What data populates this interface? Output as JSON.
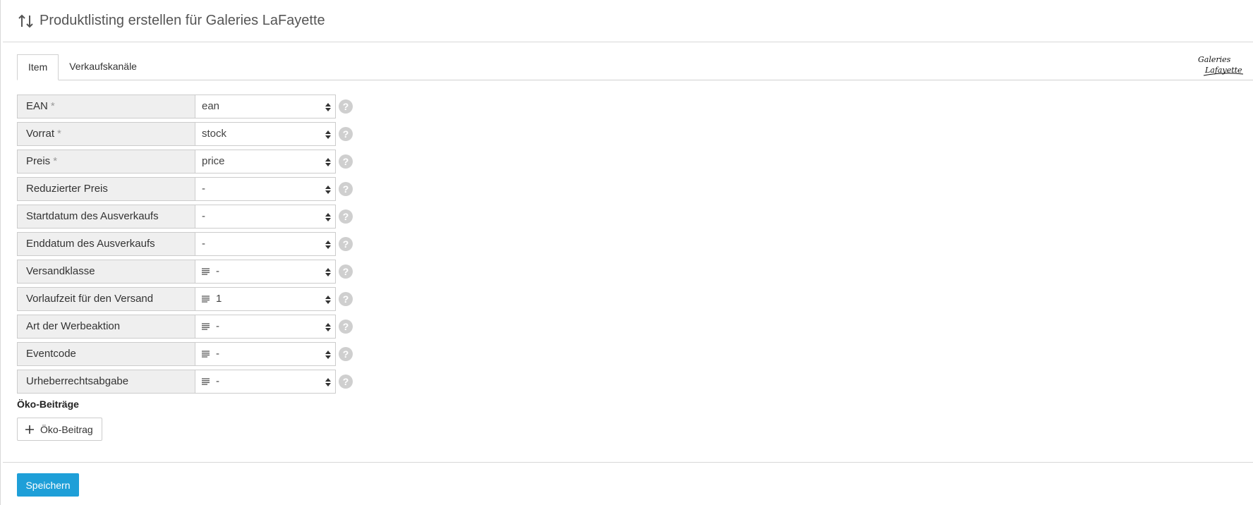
{
  "header": {
    "title": "Produktlisting erstellen für Galeries LaFayette"
  },
  "tabs": [
    {
      "label": "Item",
      "active": true
    },
    {
      "label": "Verkaufskanäle",
      "active": false
    }
  ],
  "logo": {
    "text": "Galeries Lafayette"
  },
  "form": {
    "rows": [
      {
        "label": "EAN",
        "required": "*",
        "value": "ean",
        "has_list_icon": false
      },
      {
        "label": "Vorrat",
        "required": "*",
        "value": "stock",
        "has_list_icon": false
      },
      {
        "label": "Preis",
        "required": "*",
        "value": "price",
        "has_list_icon": false
      },
      {
        "label": "Reduzierter Preis",
        "required": "",
        "value": "-",
        "has_list_icon": false
      },
      {
        "label": "Startdatum des Ausverkaufs",
        "required": "",
        "value": "-",
        "has_list_icon": false
      },
      {
        "label": "Enddatum des Ausverkaufs",
        "required": "",
        "value": "-",
        "has_list_icon": false
      },
      {
        "label": "Versandklasse",
        "required": "",
        "value": "-",
        "has_list_icon": true
      },
      {
        "label": "Vorlaufzeit für den Versand",
        "required": "",
        "value": "1",
        "has_list_icon": true
      },
      {
        "label": "Art der Werbeaktion",
        "required": "",
        "value": "-",
        "has_list_icon": true
      },
      {
        "label": "Eventcode",
        "required": "",
        "value": "-",
        "has_list_icon": true
      },
      {
        "label": "Urheberrechtsabgabe",
        "required": "",
        "value": "-",
        "has_list_icon": true
      }
    ],
    "help_glyph": "?"
  },
  "eco": {
    "section_title": "Öko-Beiträge",
    "add_label": "Öko-Beitrag"
  },
  "footer": {
    "save_label": "Speichern"
  },
  "colors": {
    "primary": "#1e9fd8",
    "label_bg": "#efefef",
    "help_bg": "#cfcfcf"
  }
}
